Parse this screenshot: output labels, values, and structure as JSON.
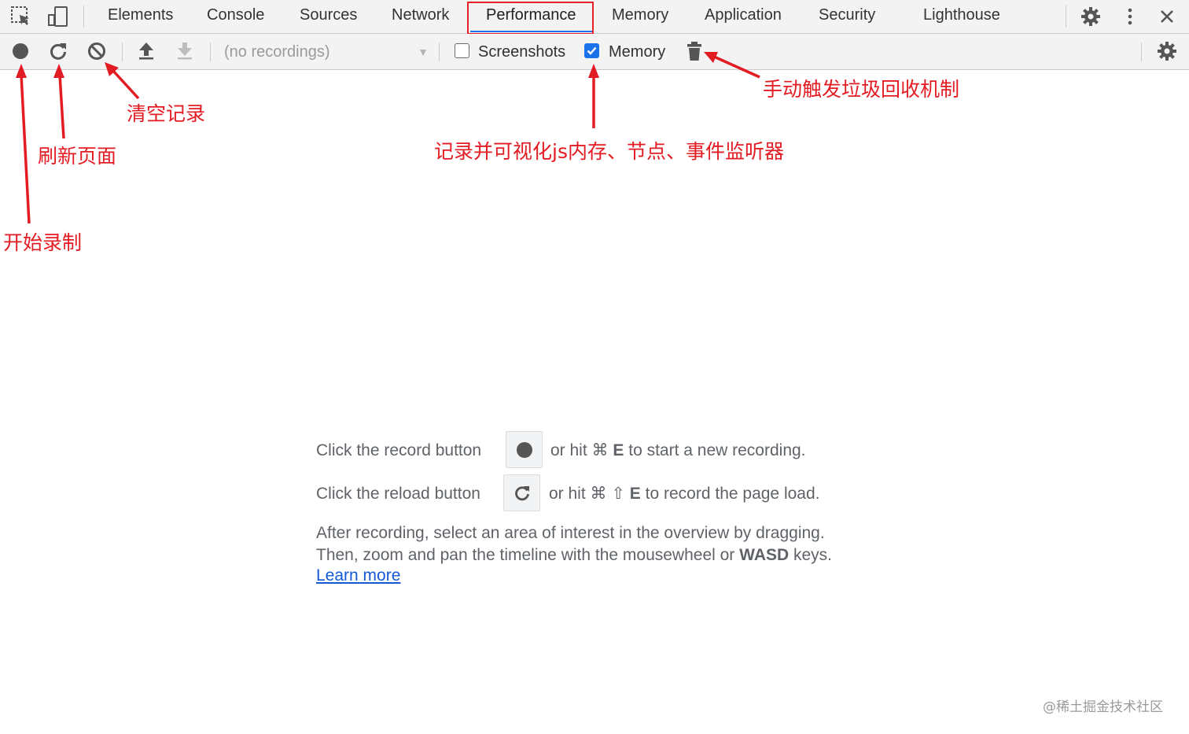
{
  "tabs": [
    {
      "label": "Elements"
    },
    {
      "label": "Console"
    },
    {
      "label": "Sources"
    },
    {
      "label": "Network"
    },
    {
      "label": "Performance",
      "selected": true
    },
    {
      "label": "Memory"
    },
    {
      "label": "Application"
    },
    {
      "label": "Security"
    },
    {
      "label": "Lighthouse"
    }
  ],
  "toolbar": {
    "recordings_select": "(no recordings)",
    "screenshots_label": "Screenshots",
    "screenshots_checked": false,
    "memory_label": "Memory",
    "memory_checked": true
  },
  "annotations": {
    "start_recording": "开始录制",
    "refresh_page": "刷新页面",
    "clear_records": "清空记录",
    "memory_visualize": "记录并可视化js内存、节点、事件监听器",
    "manual_gc": "手动触发垃圾回收机制"
  },
  "landing": {
    "record_prefix": "Click the record button",
    "record_suffix_pre": "or hit ⌘",
    "record_key": "E",
    "record_suffix_post": "to start a new recording.",
    "reload_prefix": "Click the reload button",
    "reload_suffix_pre": "or hit ⌘ ⇧",
    "reload_key": "E",
    "reload_suffix_post": "to record the page load.",
    "after_line1": "After recording, select an area of interest in the overview by dragging.",
    "after_line2_pre": "Then, zoom and pan the timeline with the mousewheel or",
    "after_line2_keys": "WASD",
    "after_line2_post": "keys.",
    "learn_more": "Learn more"
  },
  "watermark": "@稀土掘金技术社区",
  "colors": {
    "annotation": "#e31c23",
    "accent": "#1a73e8",
    "link": "#1558d6"
  },
  "icons": {
    "inspect": "inspect-element-icon",
    "device": "device-toolbar-icon",
    "settings": "gear-icon",
    "more": "more-vertical-icon",
    "close": "close-icon",
    "record": "record-icon",
    "reload": "reload-icon",
    "clear": "clear-icon",
    "upload": "load-profile-icon",
    "download": "save-profile-icon",
    "gc": "trash-icon"
  }
}
